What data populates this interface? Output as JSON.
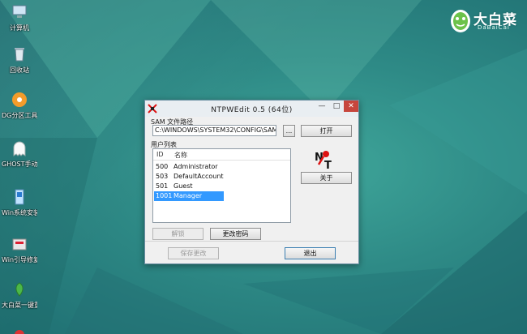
{
  "colors": {
    "desktop_bg": "#2e8a86",
    "selection": "#3399ff",
    "close_button": "#c7463d"
  },
  "desktop": {
    "icons": [
      {
        "label": "计算机",
        "icon": "computer-icon"
      },
      {
        "label": "回收站",
        "icon": "recycle-bin-icon"
      },
      {
        "label": "DG分区工具【大白菜】",
        "icon": "diskgenius-icon"
      },
      {
        "label": "GHOST手动【大白菜】",
        "icon": "ghost-icon"
      },
      {
        "label": "Win系统安装【大白菜】",
        "icon": "windows-install-icon"
      },
      {
        "label": "Win引导修复【大白菜】",
        "icon": "boot-repair-icon"
      },
      {
        "label": "大白菜一键重装【大白菜一...】",
        "icon": "dabaicai-reinstall-icon"
      }
    ]
  },
  "brand": {
    "name": "大白菜",
    "subtitle": "DaBaiCai"
  },
  "window": {
    "title": "NTPWEdit 0.5 (64位)",
    "sam_label": "SAM 文件路径",
    "sam_path": "C:\\WINDOWS\\SYSTEM32\\CONFIG\\SAM",
    "browse_label": "...",
    "open_label": "打开",
    "user_list_label": "用户列表",
    "about_label": "关于",
    "columns": {
      "id": "ID",
      "name": "名称"
    },
    "users": [
      {
        "id": "500",
        "name": "Administrator",
        "selected": false
      },
      {
        "id": "503",
        "name": "DefaultAccount",
        "selected": false
      },
      {
        "id": "501",
        "name": "Guest",
        "selected": false
      },
      {
        "id": "1001",
        "name": "Manager",
        "selected": true
      }
    ],
    "unlock_label": "解锁",
    "change_password_label": "更改密码",
    "save_label": "保存更改",
    "exit_label": "退出"
  }
}
